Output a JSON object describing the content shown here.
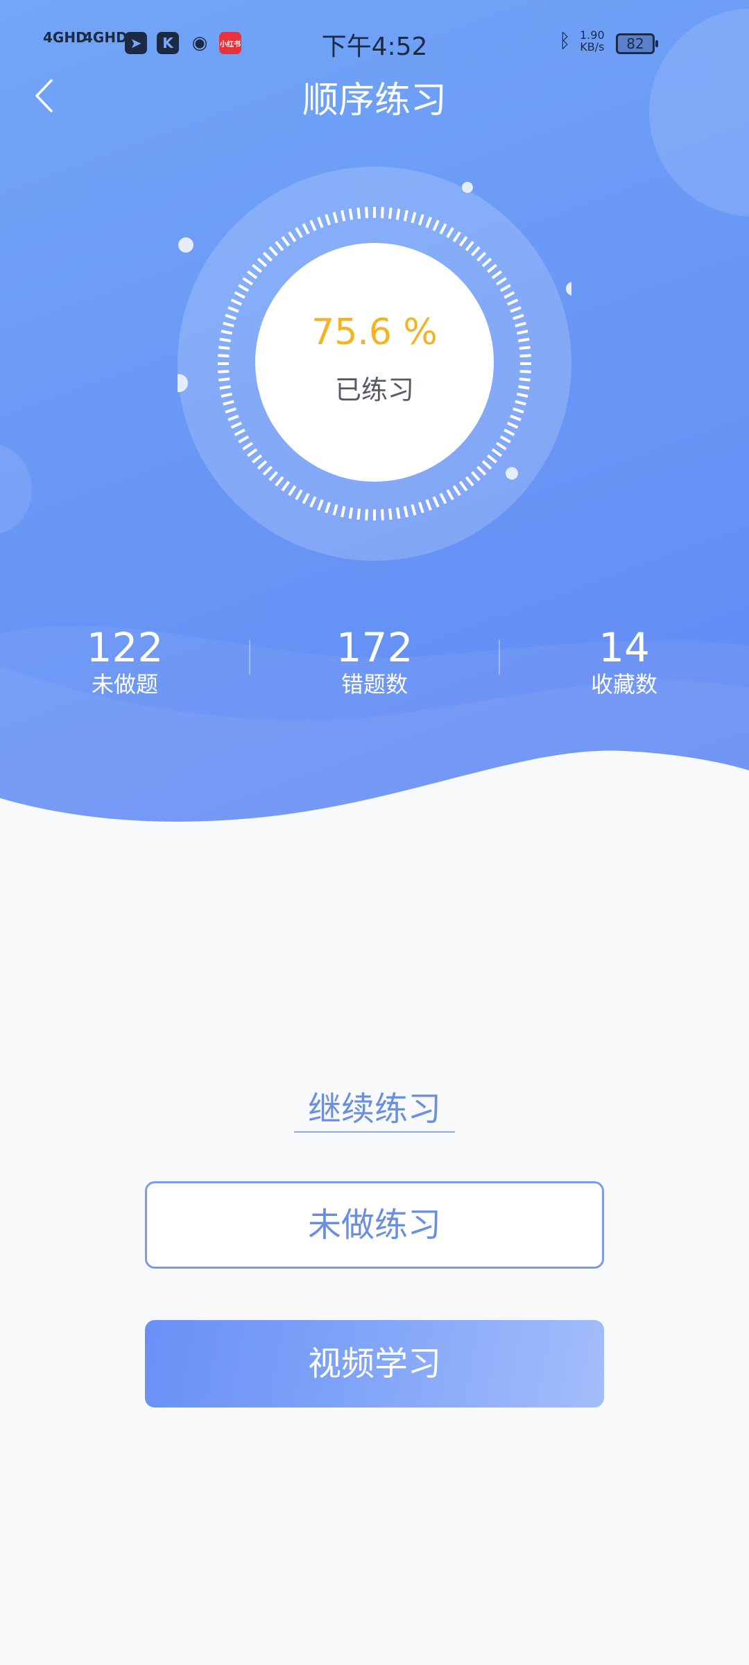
{
  "status_bar": {
    "signal_1": "4GHD",
    "signal_2": "4GHD",
    "app_icon_4": "小红书",
    "time": "下午4:52",
    "net_speed_value": "1.90",
    "net_speed_unit": "KB/s",
    "battery": "82",
    "icons": [
      "telegram-icon",
      "k-app-icon",
      "weibo-icon",
      "xiaohongshu-icon",
      "bluetooth-icon"
    ]
  },
  "header": {
    "title": "顺序练习",
    "back_icon": "chevron-left-icon"
  },
  "progress": {
    "percent_label": "75.6 %",
    "percent_value": 75.6,
    "caption": "已练习"
  },
  "stats": [
    {
      "value": "122",
      "label": "未做题"
    },
    {
      "value": "172",
      "label": "错题数"
    },
    {
      "value": "14",
      "label": "收藏数"
    }
  ],
  "actions": {
    "continue_label": "继续练习",
    "undone_label": "未做练习",
    "video_label": "视频学习"
  },
  "colors": {
    "hero": "#6a98f6",
    "percent_text": "#f4b324",
    "accent": "#6b8fe0",
    "background": "#f8f9fa"
  }
}
